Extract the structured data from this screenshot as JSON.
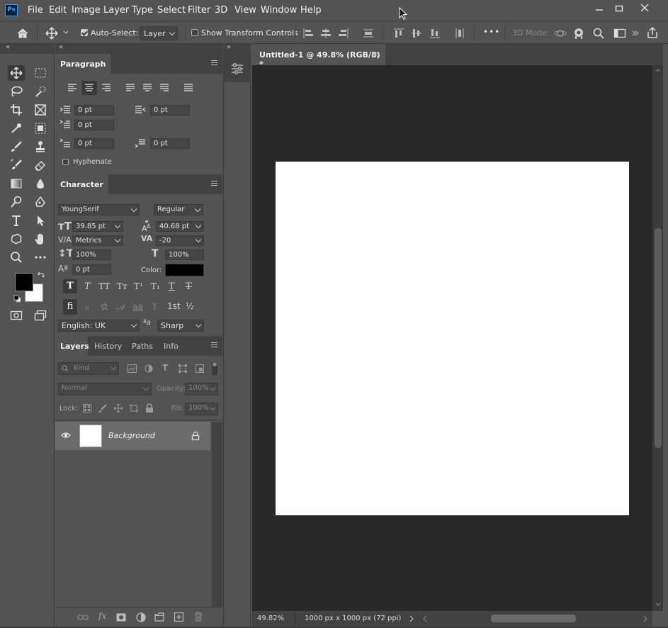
{
  "app": {
    "logo": "Ps",
    "menu": [
      "File",
      "Edit",
      "Image",
      "Layer",
      "Type",
      "Select",
      "Filter",
      "3D",
      "View",
      "Window",
      "Help"
    ]
  },
  "options_bar": {
    "auto_select_label": "Auto-Select:",
    "auto_select_checked": true,
    "auto_select_target": "Layer",
    "show_transform_label": "Show Transform Controls",
    "show_transform_checked": false,
    "more_label": "•••",
    "mode_3d_label": "3D Mode:"
  },
  "paragraph_panel": {
    "title": "Paragraph",
    "indent_left": "0 pt",
    "indent_right": "0 pt",
    "indent_first": "0 pt",
    "space_before": "0 pt",
    "space_after": "0 pt",
    "hyphenate_label": "Hyphenate"
  },
  "character_panel": {
    "title": "Character",
    "font_family": "YoungSerif",
    "font_style": "Regular",
    "font_size": "39.85 pt",
    "leading": "40.68 pt",
    "kerning": "Metrics",
    "tracking": "-20",
    "vertical_scale": "100%",
    "horizontal_scale": "100%",
    "baseline_shift": "0 pt",
    "color_label": "Color:",
    "color_value": "#000000",
    "language": "English: UK",
    "antialias_label": "ªa",
    "antialias": "Sharp",
    "style_buttons": [
      "T",
      "T",
      "TT",
      "Tт",
      "T¹",
      "T₁",
      "T",
      "T"
    ],
    "opentype_buttons": [
      "fi",
      "ℴ",
      "ﬆ",
      "𝒜",
      "aa",
      "𝕋",
      "1st",
      "½"
    ]
  },
  "layers_panel": {
    "tabs": [
      "Layers",
      "History",
      "Paths",
      "Info"
    ],
    "filter_kind": "Kind",
    "blend_mode": "Normal",
    "opacity_label": "Opacity:",
    "opacity_value": "100%",
    "lock_label": "Lock:",
    "fill_label": "Fill:",
    "fill_value": "100%",
    "layers": [
      {
        "name": "Background",
        "visible": true,
        "locked": true
      }
    ],
    "footer_fx": "fx"
  },
  "document": {
    "tab_title": "Untitled-1 @ 49.8% (RGB/8) *",
    "zoom": "49.82%",
    "doc_info": "1000 px x 1000 px (72 ppi)"
  },
  "colors": {
    "foreground": "#000000",
    "background": "#ffffff",
    "ui_bg": "#535353",
    "canvas_bg": "#282828",
    "logo_bg": "#001e36",
    "logo_fg": "#31a8ff"
  }
}
